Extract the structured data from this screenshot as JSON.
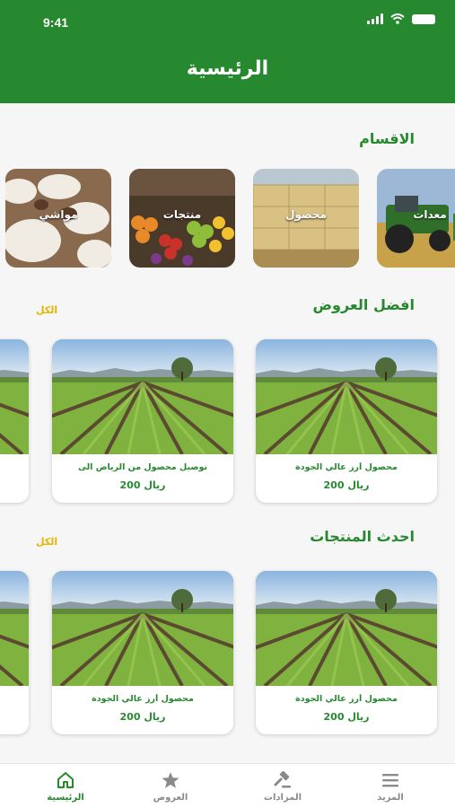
{
  "status_bar": {
    "time": "9:41"
  },
  "header": {
    "title": "الرئيسية"
  },
  "categories": {
    "title": "الاقسام",
    "items": [
      {
        "label": "معدات"
      },
      {
        "label": "محصول"
      },
      {
        "label": "منتجات"
      },
      {
        "label": "مواشي"
      }
    ]
  },
  "best_offers": {
    "title": "افضل العروض",
    "see_all": "الكل",
    "cards": [
      {
        "title": "محصول أرز عالي الجودة",
        "price": "ريال 200"
      },
      {
        "title": "توصيل محصول من الرياض الى",
        "price": "ريال 200"
      }
    ]
  },
  "latest_products": {
    "title": "احدث المنتجات",
    "see_all": "الكل",
    "cards": [
      {
        "title": "محصول أرز عالي الجودة",
        "price": "ريال 200"
      },
      {
        "title": "محصول أرز عالي الجودة",
        "price": "ريال 200"
      }
    ]
  },
  "tabbar": {
    "items": [
      {
        "label": "الرئيسية",
        "icon": "home-icon",
        "active": true
      },
      {
        "label": "العروض",
        "icon": "star-icon",
        "active": false
      },
      {
        "label": "المزادات",
        "icon": "gavel-icon",
        "active": false
      },
      {
        "label": "المزيد",
        "icon": "menu-icon",
        "active": false
      }
    ]
  },
  "colors": {
    "primary": "#27892f",
    "accent": "#e8b400",
    "inactive": "#8a8a8a"
  }
}
